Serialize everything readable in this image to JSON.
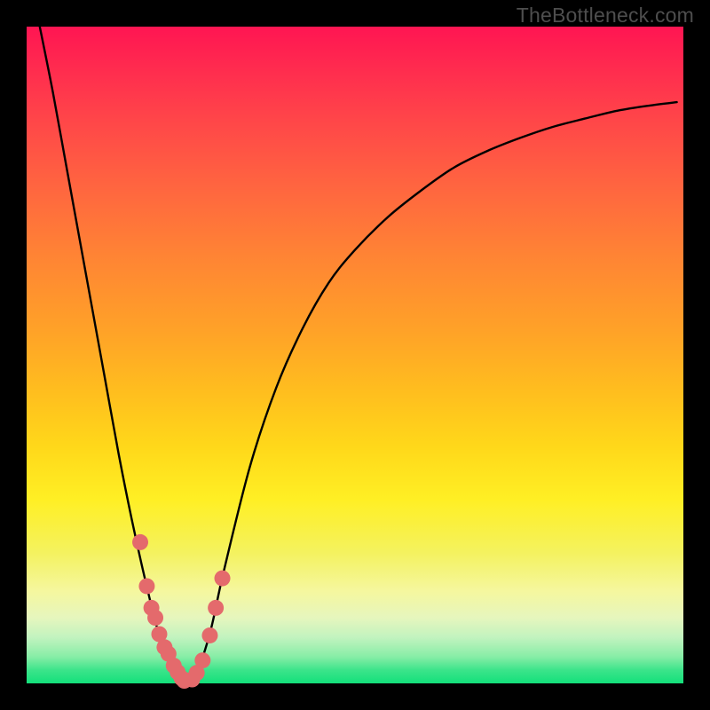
{
  "watermark": "TheBottleneck.com",
  "colors": {
    "background": "#000000",
    "curve_stroke": "#000000",
    "dot_fill": "#e46a6c",
    "gradient_top": "#ff1552",
    "gradient_bottom": "#13e07b"
  },
  "chart_data": {
    "type": "line",
    "title": "",
    "xlabel": "",
    "ylabel": "",
    "xlim": [
      0,
      100
    ],
    "ylim": [
      0,
      100
    ],
    "series": [
      {
        "name": "bottleneck-curve",
        "x": [
          2,
          4,
          6,
          8,
          10,
          12,
          14,
          16,
          18,
          20,
          22,
          24,
          26,
          28,
          30,
          34,
          38,
          42,
          46,
          50,
          55,
          60,
          65,
          70,
          75,
          80,
          85,
          90,
          95,
          99
        ],
        "y": [
          100,
          90,
          79,
          68,
          57,
          46,
          35,
          25,
          16,
          8,
          2.5,
          0,
          2,
          8,
          17,
          33,
          45,
          54,
          61,
          66,
          71,
          75,
          78.5,
          81,
          83,
          84.7,
          86,
          87.2,
          88,
          88.5
        ]
      }
    ],
    "scatter_overlay": {
      "name": "recommended-match-dots",
      "points": [
        {
          "x": 17.3,
          "y": 21.5
        },
        {
          "x": 18.3,
          "y": 14.8
        },
        {
          "x": 19.0,
          "y": 11.5
        },
        {
          "x": 19.6,
          "y": 10.0
        },
        {
          "x": 20.2,
          "y": 7.5
        },
        {
          "x": 21.0,
          "y": 5.5
        },
        {
          "x": 21.6,
          "y": 4.5
        },
        {
          "x": 22.4,
          "y": 2.7
        },
        {
          "x": 23.0,
          "y": 1.7
        },
        {
          "x": 23.6,
          "y": 0.8
        },
        {
          "x": 24.0,
          "y": 0.4
        },
        {
          "x": 25.2,
          "y": 0.6
        },
        {
          "x": 25.9,
          "y": 1.6
        },
        {
          "x": 26.8,
          "y": 3.5
        },
        {
          "x": 27.9,
          "y": 7.3
        },
        {
          "x": 28.8,
          "y": 11.5
        },
        {
          "x": 29.8,
          "y": 16.0
        }
      ]
    }
  }
}
